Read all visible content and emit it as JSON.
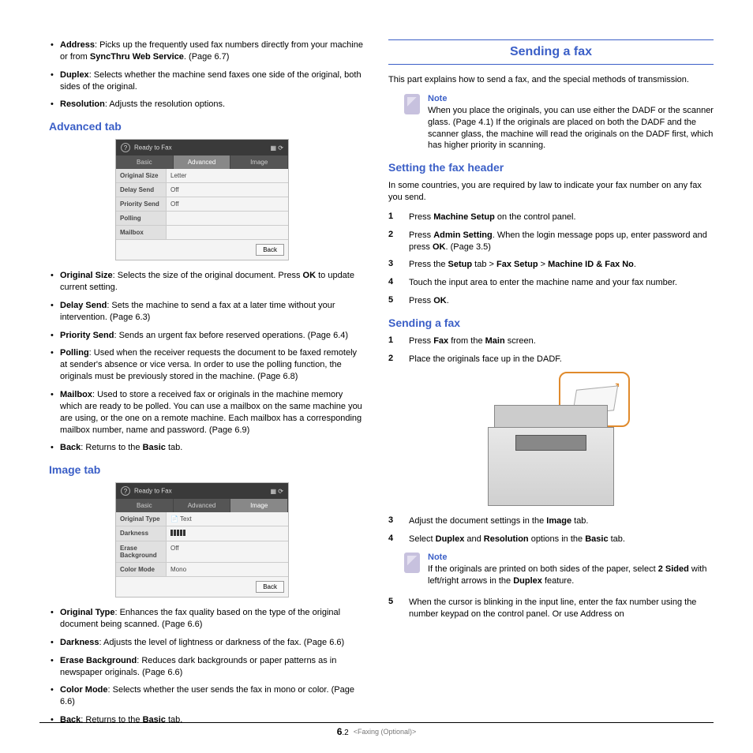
{
  "leftCol": {
    "topBullets": [
      {
        "term": "Address",
        "rest": ": Picks up the frequently used fax numbers directly from your machine or from ",
        "bold2": "SyncThru Web Service",
        "tail": ". (Page 6.7)"
      },
      {
        "term": "Duplex",
        "rest": ": Selects whether the machine send faxes one side of the original, both sides of the original."
      },
      {
        "term": "Resolution",
        "rest": ": Adjusts the resolution options."
      }
    ],
    "advHeading": "Advanced tab",
    "advScreen": {
      "title": "Ready to Fax",
      "tabs": [
        "Basic",
        "Advanced",
        "Image"
      ],
      "activeTab": 1,
      "rows": [
        {
          "k": "Original Size",
          "v": "Letter"
        },
        {
          "k": "Delay Send",
          "v": "Off"
        },
        {
          "k": "Priority Send",
          "v": "Off"
        },
        {
          "k": "Polling",
          "v": ""
        },
        {
          "k": "Mailbox",
          "v": ""
        }
      ],
      "backBtn": "Back"
    },
    "advBullets": [
      {
        "term": "Original Size",
        "rest": ": Selects the size of the original document. Press ",
        "bold2": "OK",
        "tail": " to update current setting."
      },
      {
        "term": "Delay Send",
        "rest": ": Sets the machine to send a fax at a later time without your intervention. (Page 6.3)"
      },
      {
        "term": "Priority Send",
        "rest": ": Sends an urgent fax before reserved operations. (Page 6.4)"
      },
      {
        "term": "Polling",
        "rest": ": Used when the receiver requests the document to be faxed remotely at sender's absence or vice versa. In order to use the polling function, the originals must be previously stored in the machine. (Page 6.8)"
      },
      {
        "term": "Mailbox",
        "rest": ": Used to store a received fax or originals in the machine memory which are ready to be polled. You can use a mailbox on the same machine you are using, or the one on a remote machine. Each mailbox has a corresponding mailbox number, name and password. (Page 6.9)"
      },
      {
        "term": "Back",
        "rest": ": Returns to the ",
        "bold2": "Basic",
        "tail": " tab."
      }
    ],
    "imgHeading": "Image tab",
    "imgScreen": {
      "title": "Ready to Fax",
      "tabs": [
        "Basic",
        "Advanced",
        "Image"
      ],
      "activeTab": 2,
      "rows": [
        {
          "k": "Original Type",
          "v": "Text"
        },
        {
          "k": "Darkness",
          "v": "|||||"
        },
        {
          "k": "Erase Background",
          "v": "Off"
        },
        {
          "k": "Color Mode",
          "v": "Mono"
        }
      ],
      "backBtn": "Back"
    },
    "imgBullets": [
      {
        "term": "Original Type",
        "rest": ": Enhances the fax quality based on the type of the original document being scanned. (Page 6.6)"
      },
      {
        "term": "Darkness",
        "rest": ": Adjusts the level of lightness or darkness of the fax. (Page 6.6)"
      },
      {
        "term": "Erase Background",
        "rest": ": Reduces dark backgrounds or paper patterns as in newspaper originals. (Page 6.6)"
      },
      {
        "term": "Color Mode",
        "rest": ": Selects whether the user sends the fax in mono or color. (Page 6.6)"
      },
      {
        "term": "Back",
        "rest": ": Returns to the ",
        "bold2": "Basic",
        "tail": " tab."
      }
    ]
  },
  "rightCol": {
    "sectionTitle": "Sending a fax",
    "intro": "This part explains how to send a fax, and the special methods of transmission.",
    "note1": {
      "head": "Note",
      "body": "When you place the originals, you can use either the DADF or the scanner glass. (Page 4.1) If the originals are placed on both the DADF and the scanner glass, the machine will read the originals on the DADF first, which has higher priority in scanning."
    },
    "headerHeading": "Setting the fax header",
    "headerIntro": "In some countries, you are required by law to indicate your fax number on any fax you send.",
    "headerSteps": [
      {
        "n": "1",
        "pre": "Press ",
        "b1": "Machine Setup",
        "post": " on the control panel."
      },
      {
        "n": "2",
        "pre": "Press ",
        "b1": "Admin Setting",
        "post": ". When the login message pops up, enter password and press ",
        "b2": "OK",
        "tail": ". (Page 3.5)"
      },
      {
        "n": "3",
        "pre": "Press the ",
        "b1": "Setup",
        "mid": " tab > ",
        "b2": "Fax Setup",
        "mid2": " > ",
        "b3": "Machine ID & Fax No",
        "tail": "."
      },
      {
        "n": "4",
        "pre": "Touch the input area to enter the machine name and your fax number."
      },
      {
        "n": "5",
        "pre": "Press ",
        "b1": "OK",
        "post": "."
      }
    ],
    "sendHeading": "Sending a fax",
    "sendSteps12": [
      {
        "n": "1",
        "pre": "Press ",
        "b1": "Fax",
        "mid": " from the ",
        "b2": "Main",
        "post": " screen."
      },
      {
        "n": "2",
        "pre": "Place the originals face up in the DADF."
      }
    ],
    "sendSteps34": [
      {
        "n": "3",
        "pre": "Adjust the document settings in the ",
        "b1": "Image",
        "post": " tab."
      },
      {
        "n": "4",
        "pre": "Select ",
        "b1": "Duplex",
        "mid": " and ",
        "b2": "Resolution",
        "post": " options in the ",
        "b3": "Basic",
        "tail": " tab."
      }
    ],
    "note2": {
      "head": "Note",
      "pre": "If the originals are printed on both sides of the paper, select ",
      "b1": "2 Sided",
      "mid": " with left/right arrows in the ",
      "b2": "Duplex",
      "post": " feature."
    },
    "sendStep5": {
      "n": "5",
      "t": "When the cursor is blinking in the input line, enter the fax number using the number keypad on the control panel. Or use Address on"
    }
  },
  "footer": {
    "chapter": "6",
    "page": ".2",
    "section": "<Faxing (Optional)>"
  }
}
